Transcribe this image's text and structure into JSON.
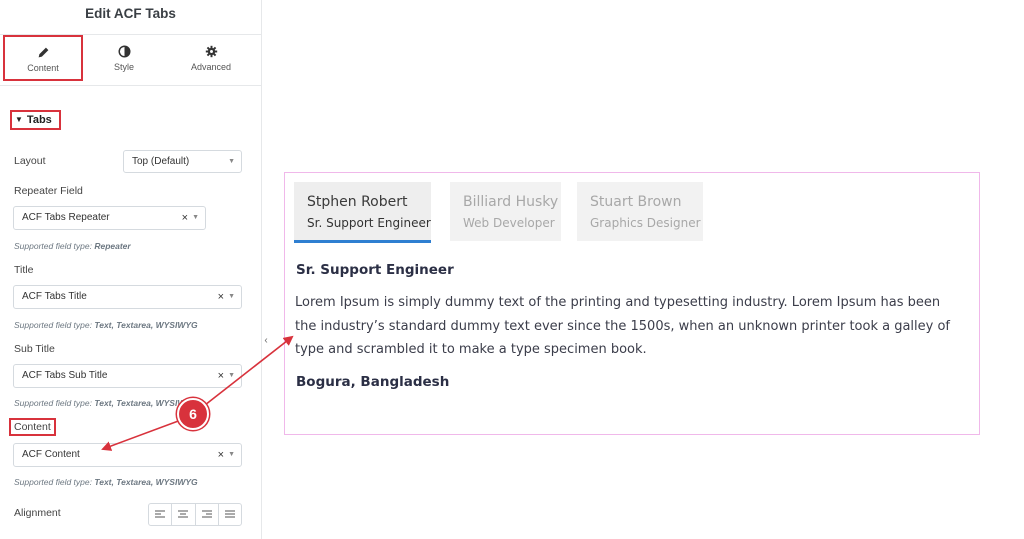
{
  "panel": {
    "title": "Edit ACF Tabs",
    "tabs": [
      {
        "label": "Content",
        "icon": "pencil-icon"
      },
      {
        "label": "Style",
        "icon": "half-circle-icon"
      },
      {
        "label": "Advanced",
        "icon": "gear-icon"
      }
    ],
    "section": "Tabs",
    "layout": {
      "label": "Layout",
      "value": "Top (Default)"
    },
    "repeater": {
      "label": "Repeater Field",
      "value": "ACF Tabs Repeater",
      "hint_prefix": "Supported field type: ",
      "hint_types": "Repeater"
    },
    "title_field": {
      "label": "Title",
      "value": "ACF Tabs Title",
      "hint_prefix": "Supported field type: ",
      "hint_types": "Text, Textarea, WYSIWYG"
    },
    "subtitle_field": {
      "label": "Sub Title",
      "value": "ACF Tabs Sub Title",
      "hint_prefix": "Supported field type: ",
      "hint_types": "Text, Textarea, WYSIWYG"
    },
    "content_field": {
      "label": "Content",
      "value": "ACF Content",
      "hint_prefix": "Supported field type: ",
      "hint_types": "Text, Textarea, WYSIWYG"
    },
    "alignment": {
      "label": "Alignment"
    },
    "clear_symbol": "×",
    "collapse_symbol": "‹"
  },
  "preview": {
    "tabs": [
      {
        "title": "Stphen Robert",
        "subtitle": "Sr. Support Engineer",
        "active": true
      },
      {
        "title": "Billiard Husky",
        "subtitle": "Web Developer",
        "active": false
      },
      {
        "title": "Stuart Brown",
        "subtitle": "Graphics Designer",
        "active": false
      }
    ],
    "content_title": "Sr. Support Engineer",
    "content_body": "Lorem Ipsum is simply dummy text of the printing and typesetting industry. Lorem Ipsum has been the industry’s standard dummy text ever since the 1500s, when an unknown printer took a galley of type and scrambled it to make a type specimen book.",
    "location": "Bogura, Bangladesh"
  },
  "annotation": {
    "step": "6"
  },
  "colors": {
    "highlight": "#d8323c",
    "active_tab_underline": "#2f7fd1",
    "preview_border": "#f0b8ea"
  }
}
